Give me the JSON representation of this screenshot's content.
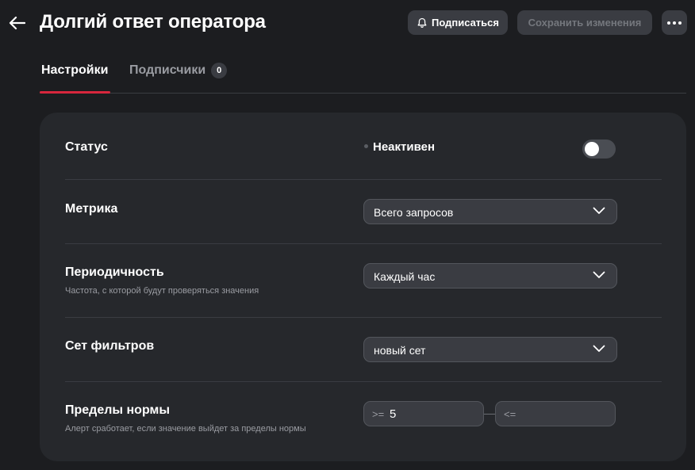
{
  "header": {
    "title": "Долгий ответ оператора",
    "subscribe_label": "Подписаться",
    "save_label": "Сохранить изменения",
    "more_label": "•••"
  },
  "tabs": [
    {
      "label": "Настройки",
      "active": true
    },
    {
      "label": "Подписчики",
      "count": "0",
      "active": false
    }
  ],
  "settings": {
    "status": {
      "label": "Статус",
      "value": "Неактивен",
      "enabled": false
    },
    "metric": {
      "label": "Метрика",
      "value": "Всего запросов"
    },
    "periodicity": {
      "label": "Периодичность",
      "hint": "Частота, с которой будут проверяться значения",
      "value": "Каждый час"
    },
    "filter_set": {
      "label": "Сет фильтров",
      "value": "новый сет"
    },
    "limits": {
      "label": "Пределы нормы",
      "hint": "Алерт сработает, если значение выйдет за пределы нормы",
      "min_prefix": ">=",
      "min_value": "5",
      "max_prefix": "<=",
      "max_value": ""
    }
  },
  "colors": {
    "background": "#1c1d20",
    "card": "#26282c",
    "accent": "#d7263d",
    "control": "#3a3c42"
  }
}
